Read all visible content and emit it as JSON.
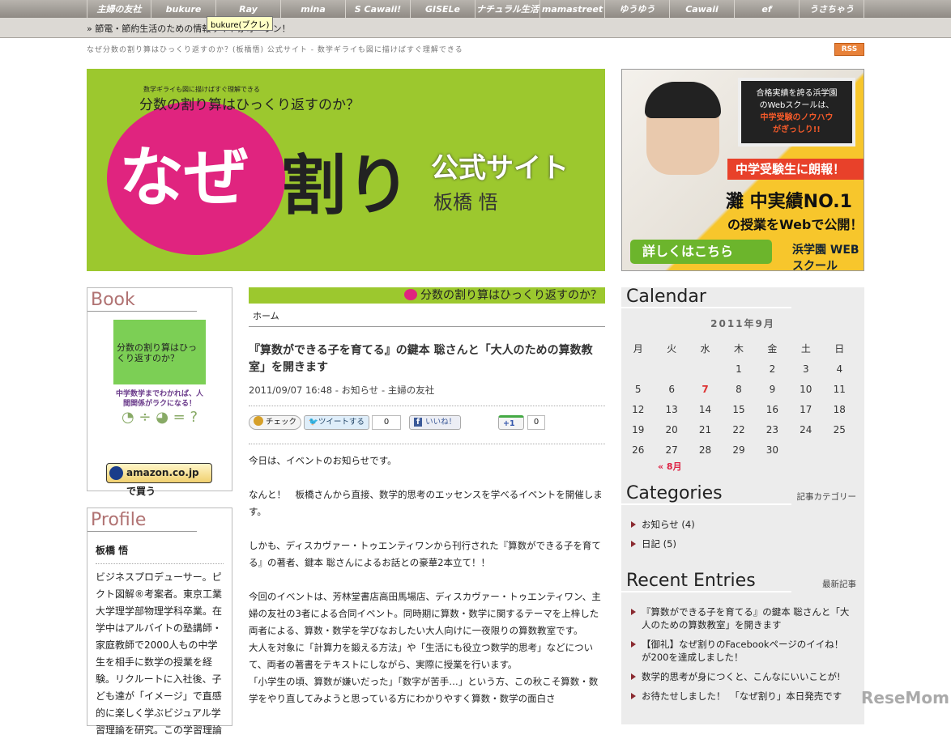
{
  "topnav": [
    "主婦の友社",
    "bukure",
    "Ray",
    "mina",
    "S Cawaii!",
    "GISELe",
    "ナチュラル生活",
    "mamastreet",
    "ゆうゆう",
    "Cawaii",
    "ef",
    "うさちゃう"
  ],
  "tooltip": "bukure(ブクレ)",
  "ticker": "» 節電・節約生活のための情報サイトがオープン！",
  "tagline": "なぜ分数の割り算はひっくり返すのか？(板橋悟) 公式サイト - 数学ギライも図に描けばすぐ理解できる",
  "rss": "RSS",
  "banner": {
    "small": "数学ギライも図に描けばすぐ理解できる",
    "subtitle": "分数の割り算はひっくり返すのか？",
    "naze": "なぜ",
    "wari": "割り",
    "official": "公式サイト",
    "author": "板橋 悟"
  },
  "ad": {
    "screen1": "合格実績を誇る浜学園",
    "screen2": "のWebスクールは、",
    "screen3": "中学受験のノウハウ",
    "screen4": "がぎっしり!!",
    "banner": "中学受験生に朗報！",
    "line1": "灘 中実績NO.1",
    "line2": "の授業をWebで公開！",
    "button": "詳しくはこちら",
    "brand": "浜学園 WEBスクール"
  },
  "book": {
    "heading": "Book",
    "cover_title": "分数の割り算はひっくり返すのか？",
    "cover_tag": "中学数学までわかれば、人間関係がラクになる！",
    "amazon": "amazon.co.jp で買う"
  },
  "profile": {
    "heading": "Profile",
    "name": "板橋 悟",
    "bio": "ビジネスプロデューサー。ピクト図解®考案者。東京工業大学理学部物理学科卒業。在学中はアルバイトの塾講師・家庭教師で2000人もの中学生を相手に数学の授業を経験。リクルートに入社後、子ども達が「イメージ」で直感的に楽しく学ぶビジュアル学習理論を研究。この学習理論"
  },
  "strip": "分数の割り算はひっくり返すのか？",
  "breadcrumb": "ホーム",
  "article": {
    "title": "『算数ができる子を育てる』の鍵本 聡さんと「大人のための算数教室」を開きます",
    "meta": "2011/09/07 16:48 - お知らせ - 主婦の友社",
    "social": {
      "check": "チェック",
      "tweet": "ツイートする",
      "tweet_count": "0",
      "like": "いいね！",
      "plus": "+1",
      "plus_count": "0"
    },
    "paragraphs": [
      "今日は、イベントのお知らせです。",
      "なんと！　板橋さんから直接、数学的思考のエッセンスを学べるイベントを開催します。",
      "しかも、ディスカヴァー・トゥエンティワンから刊行された『算数ができる子を育てる』の著者、鍵本 聡さんによるお話との豪華2本立て！！",
      "今回のイベントは、芳林堂書店高田馬場店、ディスカヴァー・トゥエンティワン、主婦の友社の3者による合同イベント。同時期に算数・数学に関するテーマを上梓した両者による、算数・数学を学びなおしたい大人向けに一夜限りの算数教室です。",
      "大人を対象に「計算力を鍛える方法」や「生活にも役立つ数学的思考」などについて、両者の著書をテキストにしながら、実際に授業を行います。",
      "「小学生の頃、算数が嫌いだった」「数字が苦手…」という方、この秋こそ算数・数学をやり直してみようと思っている方にわかりやすく算数・数学の面白さ"
    ]
  },
  "calendar": {
    "heading": "Calendar",
    "month": "2011年9月",
    "weekdays": [
      "月",
      "火",
      "水",
      "木",
      "金",
      "土",
      "日"
    ],
    "today": "7",
    "prev": "« 8月"
  },
  "categories": {
    "heading": "Categories",
    "sub": "記事カテゴリー",
    "items": [
      "お知らせ (4)",
      "日記 (5)"
    ]
  },
  "recent": {
    "heading": "Recent Entries",
    "sub": "最新記事",
    "items": [
      "『算数ができる子を育てる』の鍵本 聡さんと「大人のための算数教室」を開きます",
      "【御礼】なぜ割りのFacebookページのイイね！が200を達成しました！",
      "数学的思考が身につくと、こんなにいいことが!",
      "お待たせしました！　「なぜ割り」本日発売です"
    ]
  },
  "watermark": "ReseMom"
}
